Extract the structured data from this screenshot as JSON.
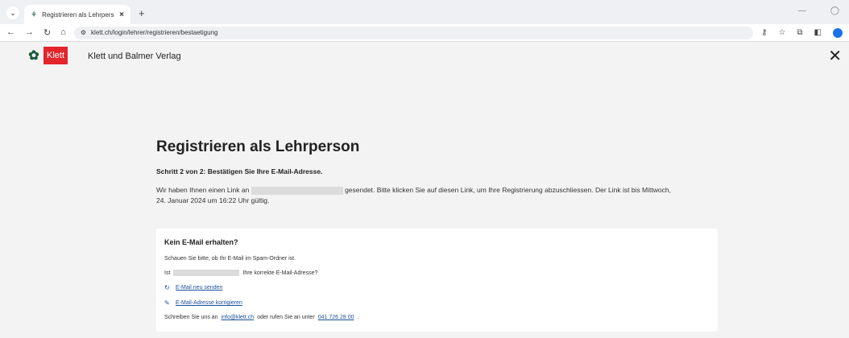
{
  "browser": {
    "tab_title": "Registrieren als Lehrperson - Kl",
    "url": "klett.ch/login/lehrer/registrieren/bestaetigung",
    "newtab": "+"
  },
  "site": {
    "logo_text": "Klett",
    "brand": "Klett und Balmer Verlag"
  },
  "main": {
    "title": "Registrieren als Lehrperson",
    "step": "Schritt 2 von 2: Bestätigen Sie Ihre E-Mail-Adresse.",
    "para_a": "Wir haben Ihnen einen Link an",
    "para_b": "gesendet. Bitte klicken Sie auf diesen Link, um Ihre Registrierung abzuschliessen. Der Link ist bis Mittwoch,",
    "para_c": "24. Januar 2024 um 16:22 Uhr gültig."
  },
  "card": {
    "title": "Kein E-Mail erhalten?",
    "spam": "Schauen Sie bitte, ob Ihr E-Mail im Spam-Ordner ist.",
    "ist": "Ist",
    "correct": "Ihre korrekte E-Mail-Adresse?",
    "resend": "E-Mail neu senden",
    "fix": "E-Mail-Adresse korrigieren",
    "contact_a": "Schreiben Sie uns an",
    "email": "info@klett.ch",
    "contact_b": "oder rufen Sie an unter",
    "phone": "041 726 28 00",
    "period": "."
  }
}
